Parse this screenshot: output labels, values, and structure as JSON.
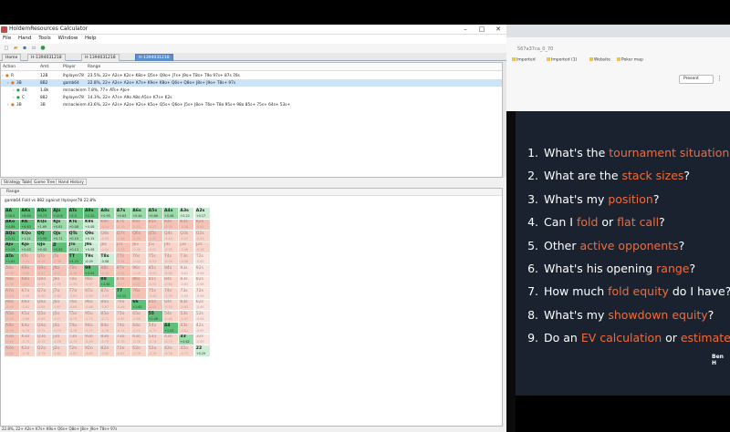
{
  "app": {
    "title": "HoldemResources Calculator",
    "menu": [
      "File",
      "Hand",
      "Tools",
      "Window",
      "Help"
    ],
    "tabs": [
      "Home",
      "H-1394031218",
      "H-1394031218",
      "H-1394031218"
    ],
    "active_tab": 3,
    "tree_headers": {
      "action": "Action",
      "amt": "Amt.",
      "player": "Player",
      "range": "Range"
    },
    "tree_rows": [
      {
        "action": "R",
        "amt": "12B",
        "player": "lhplayer78",
        "range": "23.5%, 22+ A2s+ K2s+ K8o+ Q5s+ Q9o+ J7s+ J9o+ T8s+ T9o 97s+ 87s 76s",
        "indent": 0,
        "sel": false
      },
      {
        "action": "3B",
        "amt": "8B2",
        "player": "gamb64",
        "range": "22.8%, 22+ A2s+ A2o+ K7s+ K9o+ K8o+ Q6s+ Q8o+ J8s+ J9o+ T8s+ 97s",
        "indent": 1,
        "sel": true
      },
      {
        "action": "4B",
        "amt": "1.8k",
        "player": "mrnacleinm",
        "range": "7.8%, 77+ ATs+ AJo+",
        "indent": 2,
        "sel": false
      },
      {
        "action": "C",
        "amt": "882",
        "player": "lhplayer78",
        "range": "14.3%, 22+ A7s+ A9o A8o A5s+ K7s+ K2s",
        "indent": 2,
        "sel": false
      },
      {
        "action": "3B",
        "amt": "3B",
        "player": "mrnacleinm",
        "range": "43.6%, 22+ A2s+ A2o+ K2s+ K5o+ Q5s+ Q6o+ J5s+ J8o+ T6s+ T8o 95s+ 98o 85s+ 75s+ 64s+ 53s+",
        "indent": 1,
        "sel": false
      }
    ],
    "subtabs": [
      "Strategy Table",
      "Game Tree",
      "Hand History"
    ],
    "range_panel_title": "Range",
    "range_info": "gamb64 Fold vs 882 against lhplayer78 22.8%",
    "status": "22.8%, 22+ A2s+ K7s+ K9o+ Q6s+ Q8o+ J8s+ J9o+ T8s+ 97s"
  },
  "grid": [
    [
      [
        "AA",
        "+16.5",
        "g1"
      ],
      [
        "AKs",
        "+8.64",
        "g1"
      ],
      [
        "AQs",
        "+9.73",
        "g1"
      ],
      [
        "AJs",
        "+12.6",
        "g1"
      ],
      [
        "ATs",
        "+2.3",
        "g1"
      ],
      [
        "A9s",
        "+1.22",
        "g1"
      ],
      [
        "A8s",
        "+0.95",
        "g2"
      ],
      [
        "A7s",
        "+0.63",
        "g2"
      ],
      [
        "A6s",
        "+0.44",
        "g2"
      ],
      [
        "A5s",
        "+0.66",
        "g2"
      ],
      [
        "A4s",
        "+0.46",
        "g2"
      ],
      [
        "A3s",
        "+0.22",
        "g3"
      ],
      [
        "A2s",
        "+0.17",
        "g3"
      ]
    ],
    [
      [
        "AKo",
        "+4.89",
        "g1"
      ],
      [
        "KK",
        "+6.63",
        "g1"
      ],
      [
        "KQs",
        "+1.69",
        "g2"
      ],
      [
        "KJs",
        "+0.61",
        "g2"
      ],
      [
        "KTs",
        "+0.48",
        "g2"
      ],
      [
        "K9s",
        "+0.08",
        "g3"
      ],
      [
        "K8s",
        "-0.14",
        "p1"
      ],
      [
        "K7s",
        "-0.19",
        "p1"
      ],
      [
        "K6s",
        "-0.25",
        "p1"
      ],
      [
        "K5s",
        "-0.27",
        "p1"
      ],
      [
        "K4s",
        "-0.35",
        "p1"
      ],
      [
        "K3s",
        "-0.38",
        "p1"
      ],
      [
        "K2s",
        "-0.41",
        "p1"
      ]
    ],
    [
      [
        "AQo",
        "+2.31",
        "g1"
      ],
      [
        "KQo",
        "+1.21",
        "g2"
      ],
      [
        "QQ",
        "+3.95",
        "g1"
      ],
      [
        "QJs",
        "+0.71",
        "g2"
      ],
      [
        "QTs",
        "+0.19",
        "g2"
      ],
      [
        "Q9s",
        "+0.15",
        "g3"
      ],
      [
        "Q8s",
        "-0.09",
        "p2"
      ],
      [
        "Q7s",
        "-0.36",
        "p1"
      ],
      [
        "Q6s",
        "-0.40",
        "p1"
      ],
      [
        "Q5s",
        "-0.42",
        "p1"
      ],
      [
        "Q4s",
        "-0.44",
        "p2"
      ],
      [
        "Q3s",
        "-0.47",
        "p2"
      ],
      [
        "Q2s",
        "-0.49",
        "p2"
      ]
    ],
    [
      [
        "AJo",
        "+2.29",
        "g1"
      ],
      [
        "KJo",
        "+0.43",
        "g2"
      ],
      [
        "QJo",
        "+0.43",
        "g2"
      ],
      [
        "JJ",
        "+0.83",
        "g1"
      ],
      [
        "JTs",
        "+0.13",
        "g2"
      ],
      [
        "J9s",
        "+0.08",
        "g3"
      ],
      [
        "J8s",
        "-0.04",
        "p2"
      ],
      [
        "J7s",
        "-0.33",
        "p1"
      ],
      [
        "J6s",
        "-0.48",
        "p2"
      ],
      [
        "J5s",
        "-0.52",
        "p2"
      ],
      [
        "J4s",
        "-0.55",
        "p2"
      ],
      [
        "J3s",
        "-0.56",
        "p2"
      ],
      [
        "J2s",
        "-0.58",
        "p2"
      ]
    ],
    [
      [
        "ATo",
        "+1.61",
        "g1"
      ],
      [
        "KTo",
        "-0.21",
        "p1"
      ],
      [
        "QTo",
        "-0.35",
        "p1"
      ],
      [
        "JTo",
        "-0.38",
        "p1"
      ],
      [
        "TT",
        "+4.25",
        "g1"
      ],
      [
        "T9s",
        "-0.09",
        "g3"
      ],
      [
        "T8s",
        "-0.08",
        "g3"
      ],
      [
        "T7s",
        "-0.34",
        "p1"
      ],
      [
        "T6s",
        "-0.44",
        "p2"
      ],
      [
        "T5s",
        "-0.53",
        "p2"
      ],
      [
        "T4s",
        "-0.56",
        "p2"
      ],
      [
        "T3s",
        "-0.58",
        "p2"
      ],
      [
        "T2s",
        "-0.60",
        "p3"
      ]
    ],
    [
      [
        "A9o",
        "-0.35",
        "p1"
      ],
      [
        "K9o",
        "-0.45",
        "p1"
      ],
      [
        "Q9o",
        "-0.47",
        "p1"
      ],
      [
        "J9o",
        "-0.47",
        "p1"
      ],
      [
        "T9o",
        "-0.48",
        "p1"
      ],
      [
        "99",
        "+3.04",
        "g1"
      ],
      [
        "98s",
        "-0.16",
        "p1"
      ],
      [
        "97s",
        "-0.34",
        "p1"
      ],
      [
        "96s",
        "-0.49",
        "p2"
      ],
      [
        "95s",
        "-0.55",
        "p2"
      ],
      [
        "94s",
        "-0.60",
        "p2"
      ],
      [
        "93s",
        "-0.61",
        "p3"
      ],
      [
        "92s",
        "-0.63",
        "p3"
      ]
    ],
    [
      [
        "A8o",
        "-0.36",
        "p1"
      ],
      [
        "K8o",
        "-0.51",
        "p1"
      ],
      [
        "Q8o",
        "-0.54",
        "p2"
      ],
      [
        "J8o",
        "-0.55",
        "p2"
      ],
      [
        "T8o",
        "-0.56",
        "p2"
      ],
      [
        "98o",
        "-0.57",
        "p2"
      ],
      [
        "88",
        "+2.61",
        "g1"
      ],
      [
        "87s",
        "-0.27",
        "p1"
      ],
      [
        "86s",
        "-0.41",
        "p1"
      ],
      [
        "85s",
        "-0.52",
        "p2"
      ],
      [
        "84s",
        "-0.60",
        "p2"
      ],
      [
        "83s",
        "-0.63",
        "p3"
      ],
      [
        "82s",
        "-0.64",
        "p3"
      ]
    ],
    [
      [
        "A7o",
        "-0.43",
        "p1"
      ],
      [
        "K7o",
        "-0.56",
        "p2"
      ],
      [
        "Q7o",
        "-0.60",
        "p2"
      ],
      [
        "J7o",
        "-0.62",
        "p2"
      ],
      [
        "T7o",
        "-0.63",
        "p2"
      ],
      [
        "97o",
        "-0.63",
        "p2"
      ],
      [
        "87o",
        "-0.63",
        "p2"
      ],
      [
        "77",
        "+2.12",
        "g1"
      ],
      [
        "76s",
        "-0.37",
        "p1"
      ],
      [
        "75s",
        "-0.48",
        "p2"
      ],
      [
        "74s",
        "-0.59",
        "p2"
      ],
      [
        "73s",
        "-0.64",
        "p3"
      ],
      [
        "72s",
        "-0.66",
        "p3"
      ]
    ],
    [
      [
        "A6o",
        "-0.49",
        "p1"
      ],
      [
        "K6o",
        "-0.61",
        "p2"
      ],
      [
        "Q6o",
        "-0.65",
        "p2"
      ],
      [
        "J6o",
        "-0.67",
        "p2"
      ],
      [
        "T6o",
        "-0.68",
        "p2"
      ],
      [
        "96o",
        "-0.68",
        "p2"
      ],
      [
        "86o",
        "-0.67",
        "p2"
      ],
      [
        "76o",
        "-0.66",
        "p2"
      ],
      [
        "66",
        "+1.62",
        "g1"
      ],
      [
        "65s",
        "-0.44",
        "p1"
      ],
      [
        "64s",
        "-0.53",
        "p2"
      ],
      [
        "63s",
        "-0.62",
        "p2"
      ],
      [
        "62s",
        "-0.66",
        "p3"
      ]
    ],
    [
      [
        "A5o",
        "-0.55",
        "p1"
      ],
      [
        "K5o",
        "-0.66",
        "p2"
      ],
      [
        "Q5o",
        "-0.69",
        "p2"
      ],
      [
        "J5o",
        "-0.71",
        "p2"
      ],
      [
        "T5o",
        "-0.73",
        "p2"
      ],
      [
        "95o",
        "-0.72",
        "p2"
      ],
      [
        "85o",
        "-0.71",
        "p2"
      ],
      [
        "75o",
        "-0.69",
        "p2"
      ],
      [
        "65o",
        "-0.68",
        "p2"
      ],
      [
        "55",
        "+1.48",
        "g1"
      ],
      [
        "54s",
        "-0.48",
        "p2"
      ],
      [
        "53s",
        "-0.57",
        "p2"
      ],
      [
        "52s",
        "-0.64",
        "p3"
      ]
    ],
    [
      [
        "A4o",
        "-0.59",
        "p1"
      ],
      [
        "K4o",
        "-0.70",
        "p2"
      ],
      [
        "Q4o",
        "-0.72",
        "p2"
      ],
      [
        "J4o",
        "-0.75",
        "p2"
      ],
      [
        "T4o",
        "-0.76",
        "p2"
      ],
      [
        "94o",
        "-0.77",
        "p2"
      ],
      [
        "84o",
        "-0.76",
        "p2"
      ],
      [
        "74o",
        "-0.74",
        "p2"
      ],
      [
        "64o",
        "-0.72",
        "p2"
      ],
      [
        "54o",
        "-0.71",
        "p2"
      ],
      [
        "44",
        "+1.03",
        "g1"
      ],
      [
        "43s",
        "-0.61",
        "p2"
      ],
      [
        "42s",
        "-0.67",
        "p3"
      ]
    ],
    [
      [
        "A3o",
        "-0.64",
        "p1"
      ],
      [
        "K3o",
        "-0.73",
        "p2"
      ],
      [
        "Q3o",
        "-0.76",
        "p2"
      ],
      [
        "J3o",
        "-0.78",
        "p2"
      ],
      [
        "T3o",
        "-0.79",
        "p2"
      ],
      [
        "93o",
        "-0.80",
        "p2"
      ],
      [
        "83o",
        "-0.79",
        "p2"
      ],
      [
        "73o",
        "-0.78",
        "p2"
      ],
      [
        "63o",
        "-0.76",
        "p2"
      ],
      [
        "53o",
        "-0.74",
        "p2"
      ],
      [
        "43o",
        "-0.75",
        "p2"
      ],
      [
        "33",
        "+0.62",
        "g2"
      ],
      [
        "32s",
        "-0.69",
        "p3"
      ]
    ],
    [
      [
        "A2o",
        "-0.67",
        "p1"
      ],
      [
        "K2o",
        "-0.76",
        "p2"
      ],
      [
        "Q2o",
        "-0.79",
        "p2"
      ],
      [
        "J2o",
        "-0.81",
        "p2"
      ],
      [
        "T2o",
        "-0.82",
        "p2"
      ],
      [
        "92o",
        "-0.83",
        "p2"
      ],
      [
        "82o",
        "-0.82",
        "p2"
      ],
      [
        "72o",
        "-0.81",
        "p2"
      ],
      [
        "62o",
        "-0.79",
        "p2"
      ],
      [
        "52o",
        "-0.78",
        "p2"
      ],
      [
        "42o",
        "-0.78",
        "p2"
      ],
      [
        "32o",
        "-0.77",
        "p2"
      ],
      [
        "22",
        "+0.29",
        "g3"
      ]
    ]
  ],
  "browser": {
    "url": "567a37ca_0_70",
    "bookmarks": [
      "Imported",
      "Imported (1)",
      "Website",
      "Poker map"
    ],
    "present_label": "Present",
    "menu_icon": "⋮"
  },
  "slide": {
    "items": [
      {
        "n": "1.",
        "parts": [
          [
            "What's the ",
            false
          ],
          [
            "tournament situation",
            true
          ],
          [
            "?",
            false
          ]
        ]
      },
      {
        "n": "2.",
        "parts": [
          [
            "What are the ",
            false
          ],
          [
            "stack sizes",
            true
          ],
          [
            "?",
            false
          ]
        ]
      },
      {
        "n": "3.",
        "parts": [
          [
            "What's my ",
            false
          ],
          [
            "position",
            true
          ],
          [
            "?",
            false
          ]
        ]
      },
      {
        "n": "4.",
        "parts": [
          [
            "Can I ",
            false
          ],
          [
            "fold",
            true
          ],
          [
            " or ",
            false
          ],
          [
            "flat call",
            true
          ],
          [
            "?",
            false
          ]
        ]
      },
      {
        "n": "5.",
        "parts": [
          [
            "Other ",
            false
          ],
          [
            "active opponents",
            true
          ],
          [
            "?",
            false
          ]
        ]
      },
      {
        "n": "6.",
        "parts": [
          [
            "What's his opening ",
            false
          ],
          [
            "range",
            true
          ],
          [
            "?",
            false
          ]
        ]
      },
      {
        "n": "7.",
        "parts": [
          [
            "How much ",
            false
          ],
          [
            "fold equity",
            true
          ],
          [
            " do I have?",
            false
          ]
        ]
      },
      {
        "n": "8.",
        "parts": [
          [
            "What's my ",
            false
          ],
          [
            "showdown equity",
            true
          ],
          [
            "?",
            false
          ]
        ]
      },
      {
        "n": "9.",
        "parts": [
          [
            "Do an ",
            false
          ],
          [
            "EV calculation",
            true
          ],
          [
            " or ",
            false
          ],
          [
            "estimate",
            true
          ]
        ]
      }
    ],
    "author": "Ben H",
    "highlight_color": "#f26b3a"
  }
}
